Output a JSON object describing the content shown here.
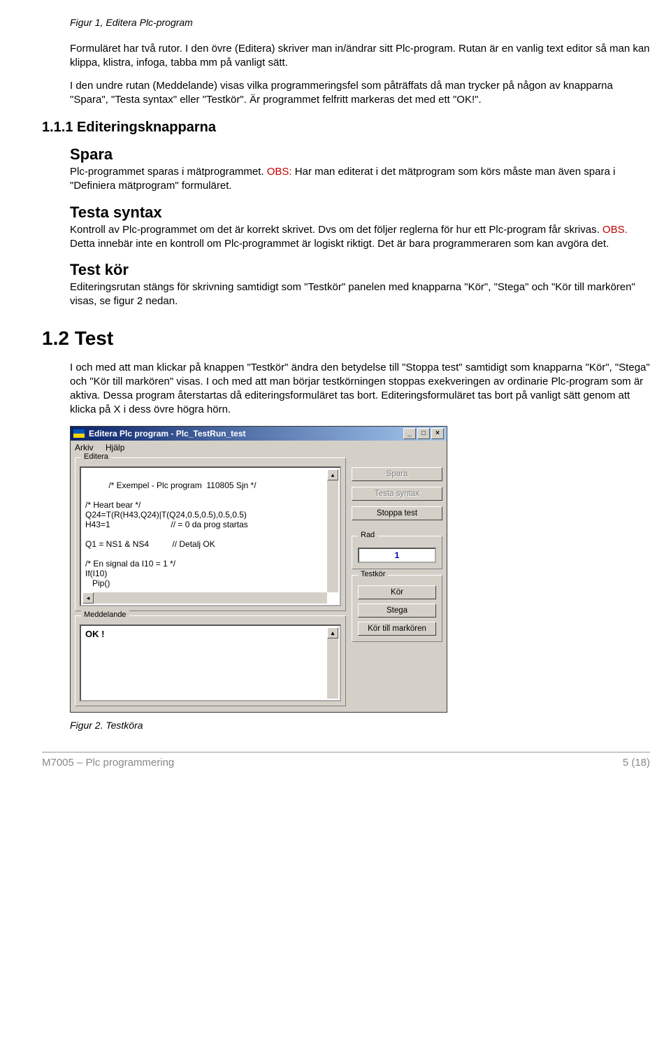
{
  "figure1_caption": "Figur 1, Editera Plc-program",
  "intro_p1": "Formuläret har två rutor. I den övre (Editera) skriver man in/ändrar sitt Plc-program. Rutan är en vanlig text editor så man kan klippa, klistra, infoga, tabba mm på vanligt sätt.",
  "intro_p2": "I den undre rutan (Meddelande) visas vilka programmeringsfel som påträffats då man trycker på någon av knapparna \"Spara\", \"Testa syntax\" eller \"Testkör\". Är programmet felfritt markeras det med ett \"OK!\".",
  "sec_111_title": "1.1.1  Editeringsknapparna",
  "spara_h": "Spara",
  "spara_p_a": "Plc-programmet sparas i mätprogrammet. ",
  "obs1": "OBS:",
  "spara_p_b": " Har man editerat i det mätprogram som körs måste man även spara i \"Definiera mätprogram\" formuläret.",
  "testa_h": "Testa syntax",
  "testa_p_a": "Kontroll av Plc-programmet om det är korrekt skrivet. Dvs om det följer reglerna för hur ett Plc-program får skrivas. ",
  "obs2": "OBS.",
  "testa_p_b": " Detta innebär inte en kontroll om Plc-programmet är logiskt riktigt. Det är bara programmeraren som kan avgöra det.",
  "testkor_h": "Test kör",
  "testkor_p": "Editeringsrutan stängs för skrivning samtidigt som \"Testkör\" panelen med knapparna \"Kör\", \"Stega\" och \"Kör till markören\" visas, se figur 2 nedan.",
  "sec_12_title": "1.2 Test",
  "sec_12_p": "I och med att man klickar på knappen \"Testkör\" ändra den betydelse till \"Stoppa test\" samtidigt som knapparna \"Kör\", \"Stega\" och \"Kör till markören\" visas. I och med att man börjar testkörningen stoppas exekveringen av ordinarie Plc-program som är aktiva. Dessa program återstartas då editeringsformuläret tas bort. Editeringsformuläret tas bort på vanligt sätt genom att klicka på X i dess övre högra hörn.",
  "figure2_caption": "Figur 2. Testköra",
  "footer_left": "M7005 – Plc programmering",
  "footer_right": "5 (18)",
  "win": {
    "title": "Editera Plc program - Plc_TestRun_test",
    "menu_arkiv": "Arkiv",
    "menu_hjalp": "Hjälp",
    "grp_editera": "Editera",
    "grp_meddelande": "Meddelande",
    "grp_rad": "Rad",
    "grp_testkor": "Testkör",
    "editor_text": "/* Exempel - Plc program  110805 Sjn */\n\n/* Heart bear */\nQ24=T(R(H43,Q24)|T(Q24,0.5,0.5),0.5,0.5)\nH43=1                          // = 0 da prog startas\n\nQ1 = NS1 & NS4          // Detalj OK\n\n/* En signal da I10 = 1 */\nIf(I10)\n   Pip()",
    "msg_text": "OK !",
    "btn_spara": "Spara",
    "btn_testa": "Testa syntax",
    "btn_stoppa": "Stoppa test",
    "rad_value": "1",
    "btn_kor": "Kör",
    "btn_stega": "Stega",
    "btn_kor_till": "Kör till markören"
  }
}
